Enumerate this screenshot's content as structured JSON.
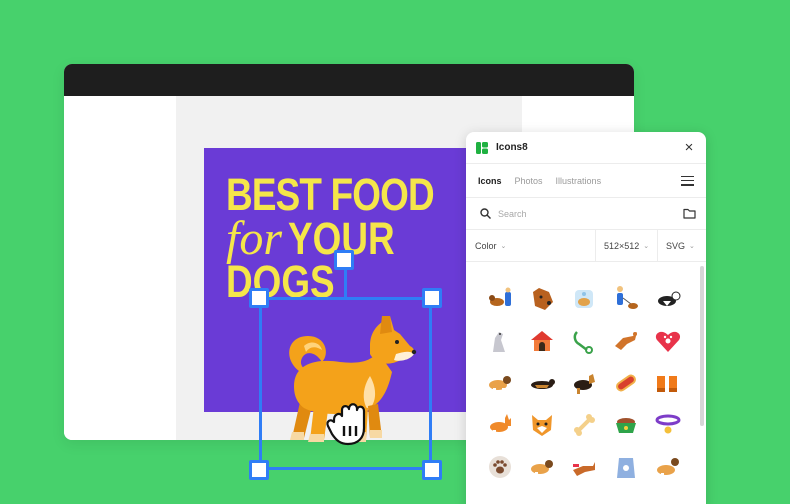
{
  "artboard": {
    "headline_line1": "BEST FOOD",
    "headline_for": "for",
    "headline_your": "YOUR",
    "headline_line3": "DOGS",
    "background": "#6a3bd6",
    "text_color": "#f5e64a"
  },
  "selection_color": "#2f7df6",
  "plugin": {
    "title": "Icons8",
    "close_glyph": "×",
    "tabs": [
      "Icons",
      "Photos",
      "Illustrations"
    ],
    "active_tab": "Icons",
    "search_placeholder": "Search",
    "filters": {
      "color": "Color",
      "size": "512×512",
      "format": "SVG"
    },
    "brand_color": "#1fb141",
    "icon_grid": [
      [
        "dog-walk-icon",
        "dog-head-icon",
        "dog-shower-icon",
        "dog-walker-icon",
        "border-collie-icon"
      ],
      [
        "greyhound-icon",
        "dog-house-icon",
        "dog-leash-icon",
        "jumping-dog-icon",
        "paw-heart-icon"
      ],
      [
        "beagle-icon",
        "dachshund-icon",
        "german-shepherd-icon",
        "hot-dog-icon",
        "dog-boots-icon"
      ],
      [
        "corgi-icon",
        "shiba-face-icon",
        "dog-bone-icon",
        "dog-bowl-icon",
        "dog-collar-icon"
      ],
      [
        "paw-print-icon",
        "beagle-icon-2",
        "running-dog-icon",
        "dog-food-bag-icon",
        "beagle-icon-3"
      ]
    ]
  }
}
